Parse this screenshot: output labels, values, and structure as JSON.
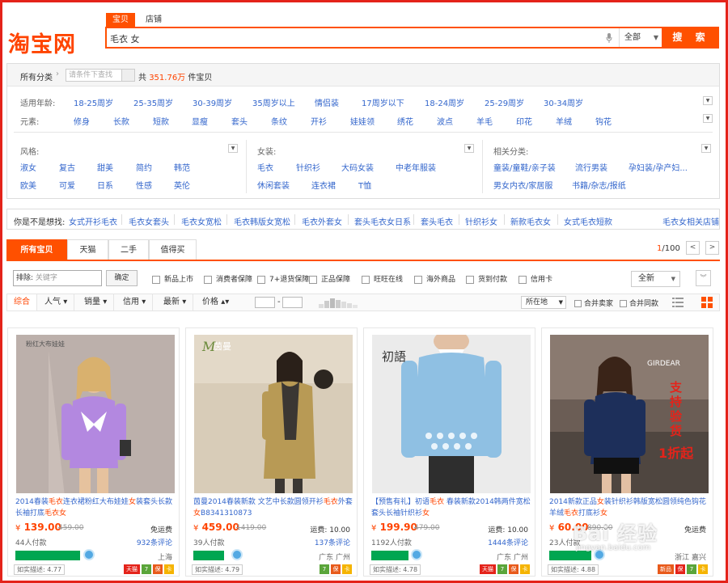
{
  "header": {
    "logo": "淘宝网",
    "search_tabs": [
      "宝贝",
      "店铺"
    ],
    "query": "毛衣 女",
    "scope": "全部",
    "search_button": "搜 索"
  },
  "panel": {
    "all_categories": "所有分类",
    "filter_placeholder": "请条件下查找",
    "total_prefix": "共",
    "total": "351.76万",
    "total_suffix": "件宝贝",
    "age_label": "适用年龄:",
    "ages": [
      "18-25周岁",
      "25-35周岁",
      "30-39周岁",
      "35周岁以上",
      "情侣装",
      "17周岁以下",
      "18-24周岁",
      "25-29周岁",
      "30-34周岁"
    ],
    "element_label": "元素:",
    "elements": [
      "修身",
      "长款",
      "短款",
      "显瘦",
      "套头",
      "条纹",
      "开衫",
      "娃娃领",
      "绣花",
      "波点",
      "羊毛",
      "印花",
      "羊绒",
      "钩花"
    ],
    "style_label": "风格:",
    "styles": [
      "淑女",
      "复古",
      "甜美",
      "简约",
      "韩范",
      "欧美",
      "可爱",
      "日系",
      "性感",
      "英伦"
    ],
    "women_label": "女装:",
    "women": [
      "毛衣",
      "针织衫",
      "大码女装",
      "中老年服装",
      "休闲套装",
      "连衣裙",
      "T恤"
    ],
    "related_label": "相关分类:",
    "related": [
      "童装/童鞋/亲子装",
      "流行男装",
      "孕妇装/孕产妇...",
      "男女内衣/家居服",
      "书籍/杂志/报纸"
    ]
  },
  "suggest": {
    "label": "你是不是想找:",
    "items": [
      "女式开衫毛衣",
      "毛衣女套头",
      "毛衣女宽松",
      "毛衣韩版女宽松",
      "毛衣外套女",
      "套头毛衣女日系",
      "套头毛衣",
      "针织衫女",
      "新款毛衣女",
      "女式毛衣短款"
    ],
    "right": "毛衣女相关店铺"
  },
  "tabs": [
    "所有宝贝",
    "天猫",
    "二手",
    "值得买"
  ],
  "pager": {
    "current": "1",
    "total": "/100",
    "prev": "<",
    "next": ">"
  },
  "filters": {
    "exclude_label": "排除:",
    "exclude_placeholder": "关键字",
    "ok": "确定",
    "checks": [
      "新品上市",
      "消费者保障",
      "7+退货保障",
      "正品保障",
      "旺旺在线",
      "海外商品",
      "货到付款",
      "信用卡"
    ],
    "scope": "全新"
  },
  "sort": {
    "items": [
      "综合",
      "人气",
      "销量",
      "信用",
      "最新",
      "价格"
    ],
    "dash": "-",
    "location": "所在地",
    "merge_sellers": "合并卖家",
    "merge_same": "合并同款"
  },
  "products": [
    {
      "title_a": "2014春装",
      "hl1": "毛衣",
      "title_b": "连衣裙粉红大布娃娃",
      "hl2": "女",
      "title_c": "装套头长款长袖打底",
      "hl3": "毛衣女",
      "title_d": "",
      "price": "139.00",
      "orig": "459.00",
      "ship": "免运费",
      "sold": "44人付款",
      "reviews": "932条评论",
      "city": "上海",
      "desc": "如实描述: 4.77",
      "img_brand": "粉红大布娃娃"
    },
    {
      "title_a": "茵曼2014春装新款 文艺中长款圆领开衫",
      "hl1": "毛衣",
      "title_b": "外套",
      "hl2": "女",
      "title_c": "B8341310873",
      "hl3": "",
      "title_d": "",
      "price": "459.00",
      "orig": "1419.00",
      "ship": "运费: 10.00",
      "sold": "39人付款",
      "reviews": "137条评论",
      "city": "广东 广州",
      "desc": "如实描述: 4.79",
      "img_brand": "茵曼"
    },
    {
      "title_a": "【预售有礼】初语",
      "hl1": "毛衣",
      "title_b": " 春装新款2014韩两件宽松套头长袖针织衫",
      "hl2": "女",
      "title_c": "",
      "hl3": "",
      "title_d": "",
      "price": "199.90",
      "orig": "479.00",
      "ship": "运费: 10.00",
      "sold": "1192人付款",
      "reviews": "1444条评论",
      "city": "广东 广州",
      "desc": "如实描述: 4.78",
      "img_brand": "初語"
    },
    {
      "title_a": "2014新款正品",
      "hl1": "女",
      "title_b": "装针织衫韩版宽松圆领纯色钩花羊绒",
      "hl2": "毛衣",
      "title_c": "打底衫",
      "hl3": "女",
      "title_d": "",
      "price": "60.00",
      "orig": "890.00",
      "ship": "免运费",
      "sold": "23人付款",
      "reviews": "",
      "city": "浙江 嘉兴",
      "desc": "如实描述: 4.88",
      "img_brand": "GIRDEAR"
    }
  ],
  "watermark": {
    "text": "Bai 经验",
    "url": "jingyan.baidu.com"
  },
  "colors": {
    "accent": "#ff5000",
    "link": "#3366cc",
    "price": "#ff4400"
  }
}
